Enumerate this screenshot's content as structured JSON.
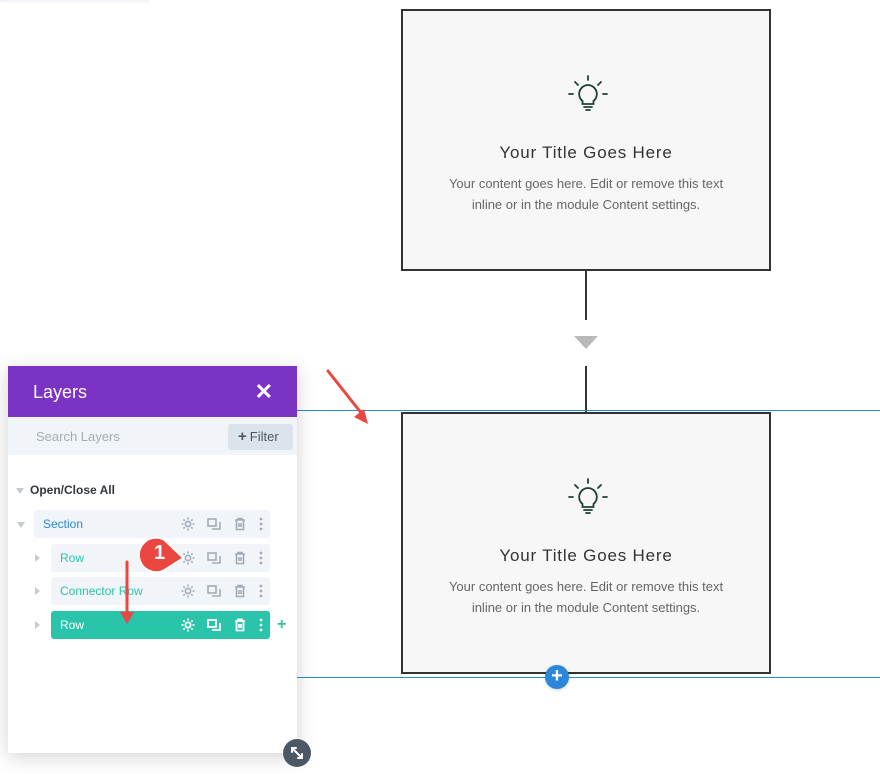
{
  "cards": [
    {
      "title": "Your Title Goes Here",
      "body": "Your content goes here. Edit or remove this text inline or in the module Content settings.",
      "icon": "lightbulb-icon"
    },
    {
      "title": "Your Title Goes Here",
      "body": "Your content goes here. Edit or remove this text inline or in the module Content settings.",
      "icon": "lightbulb-icon"
    }
  ],
  "layers_panel": {
    "title": "Layers",
    "close_icon": "close-icon",
    "search_placeholder": "Search Layers",
    "filter_label": "Filter",
    "open_close_label": "Open/Close All",
    "items": [
      {
        "label": "Section",
        "color": "#2b87da"
      },
      {
        "label": "Row",
        "color": "#29c4a9"
      },
      {
        "label": "Connector Row",
        "color": "#29c4a9"
      },
      {
        "label": "Row",
        "color": "#ffffff",
        "active": true
      }
    ]
  },
  "annotation": {
    "badge_number": "1",
    "badge_color": "#e9473f",
    "arrow_color": "#e9473f"
  },
  "colors": {
    "accent_purple": "#7b33c4",
    "accent_teal": "#29c4a9",
    "accent_blue": "#2b87da"
  }
}
